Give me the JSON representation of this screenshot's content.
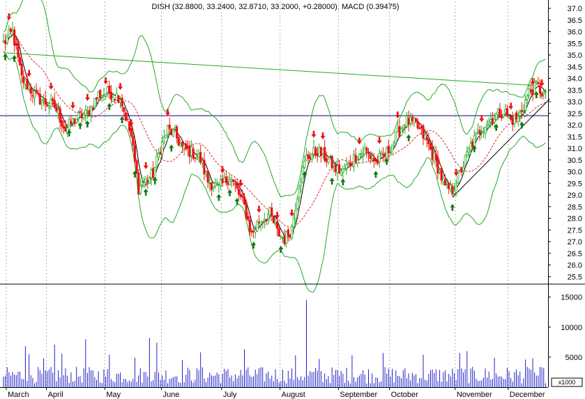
{
  "chart_data": [
    {
      "panel": "price",
      "type": "candlestick",
      "title": "DISH (32.8800, 33.2400, 32.8710, 33.2000, +0.28000), MACD (0.39475)",
      "ylim": [
        25.2,
        37.2
      ],
      "y_ticks": [
        "37.0",
        "36.5",
        "36.0",
        "35.5",
        "35.0",
        "34.5",
        "34.0",
        "33.5",
        "33.0",
        "32.5",
        "32.0",
        "31.5",
        "31.0",
        "30.5",
        "30.0",
        "29.5",
        "29.0",
        "28.5",
        "28.0",
        "27.5",
        "27.0",
        "26.5",
        "26.0",
        "25.5"
      ],
      "x_ticks": [
        "March",
        "April",
        "May",
        "June",
        "July",
        "August",
        "September",
        "October",
        "November",
        "December"
      ],
      "month_start_days": [
        0,
        22,
        54,
        85,
        118,
        150,
        182,
        210,
        246,
        275
      ],
      "day_count": 298,
      "price_anchors": [
        [
          0,
          35.5
        ],
        [
          5,
          36.0
        ],
        [
          10,
          34.0
        ],
        [
          18,
          33.2
        ],
        [
          22,
          33.0
        ],
        [
          28,
          32.8
        ],
        [
          34,
          31.8
        ],
        [
          40,
          32.3
        ],
        [
          46,
          32.5
        ],
        [
          52,
          33.3
        ],
        [
          58,
          33.4
        ],
        [
          64,
          33.2
        ],
        [
          70,
          31.5
        ],
        [
          74,
          29.3
        ],
        [
          78,
          29.6
        ],
        [
          82,
          29.9
        ],
        [
          86,
          31.0
        ],
        [
          90,
          31.8
        ],
        [
          94,
          31.6
        ],
        [
          98,
          31.0
        ],
        [
          104,
          30.8
        ],
        [
          108,
          30.5
        ],
        [
          112,
          29.6
        ],
        [
          118,
          29.3
        ],
        [
          124,
          29.8
        ],
        [
          128,
          29.2
        ],
        [
          132,
          28.5
        ],
        [
          136,
          27.3
        ],
        [
          140,
          27.9
        ],
        [
          146,
          28.2
        ],
        [
          150,
          27.4
        ],
        [
          154,
          27.1
        ],
        [
          158,
          27.6
        ],
        [
          162,
          29.5
        ],
        [
          166,
          30.6
        ],
        [
          172,
          30.9
        ],
        [
          178,
          30.5
        ],
        [
          182,
          30.1
        ],
        [
          186,
          30.0
        ],
        [
          192,
          30.6
        ],
        [
          198,
          30.9
        ],
        [
          204,
          30.4
        ],
        [
          210,
          30.8
        ],
        [
          216,
          31.6
        ],
        [
          220,
          32.2
        ],
        [
          226,
          32.0
        ],
        [
          232,
          31.3
        ],
        [
          238,
          30.2
        ],
        [
          242,
          29.3
        ],
        [
          246,
          29.2
        ],
        [
          250,
          29.9
        ],
        [
          256,
          31.1
        ],
        [
          262,
          31.9
        ],
        [
          268,
          32.3
        ],
        [
          274,
          32.6
        ],
        [
          278,
          32.2
        ],
        [
          282,
          32.3
        ],
        [
          288,
          33.4
        ],
        [
          292,
          33.7
        ],
        [
          297,
          33.2
        ]
      ],
      "price_line_level": 32.4,
      "resistance_line": [
        [
          0,
          35.1
        ],
        [
          290,
          33.7
        ]
      ],
      "support_line": [
        [
          246,
          28.9
        ],
        [
          297,
          33.0
        ]
      ],
      "buy_signal_days": [
        1,
        6,
        36,
        42,
        46,
        58,
        65,
        72,
        78,
        83,
        92,
        118,
        124,
        128,
        137,
        152,
        165,
        180,
        186,
        204,
        210,
        222,
        246,
        258,
        270,
        284,
        292
      ],
      "sell_signal_days": [
        3,
        8,
        14,
        26,
        38,
        46,
        56,
        64,
        70,
        78,
        90,
        120,
        130,
        140,
        150,
        158,
        170,
        175,
        195,
        206,
        216,
        238,
        248,
        262,
        278,
        290,
        295
      ]
    },
    {
      "panel": "volume",
      "type": "bar",
      "unit_label": "x1000",
      "ylim": [
        0,
        16000
      ],
      "y_ticks": [
        "15000",
        "10000",
        "5000"
      ],
      "spikes": [
        [
          12,
          6800
        ],
        [
          14,
          5500
        ],
        [
          22,
          4800
        ],
        [
          28,
          7100
        ],
        [
          32,
          5600
        ],
        [
          45,
          8000
        ],
        [
          58,
          5400
        ],
        [
          72,
          4900
        ],
        [
          80,
          8200
        ],
        [
          84,
          7400
        ],
        [
          98,
          4500
        ],
        [
          108,
          5800
        ],
        [
          132,
          6300
        ],
        [
          160,
          5300
        ],
        [
          173,
          4700
        ],
        [
          191,
          5300
        ],
        [
          208,
          5700
        ],
        [
          230,
          5400
        ],
        [
          250,
          5700
        ],
        [
          254,
          6000
        ],
        [
          269,
          4900
        ],
        [
          286,
          4600
        ],
        [
          290,
          4800
        ]
      ],
      "big_spike": [
        166,
        14500
      ]
    }
  ]
}
